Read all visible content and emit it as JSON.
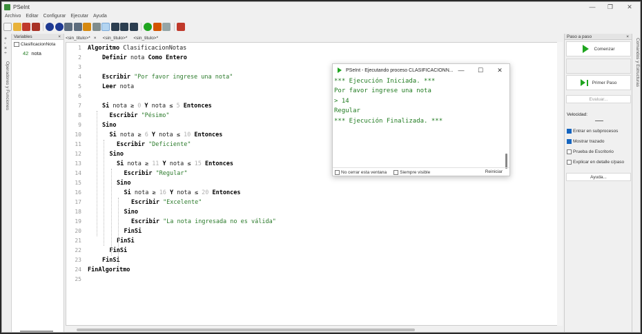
{
  "window": {
    "title": "PSeInt",
    "min": "—",
    "max": "❐",
    "close": "✕"
  },
  "menu": [
    "Archivo",
    "Editar",
    "Configurar",
    "Ejecutar",
    "Ayuda"
  ],
  "left_strip": {
    "label": "Operadores y Funciones"
  },
  "variables": {
    "header": "Variables",
    "close": "×",
    "tree_root": "ClasificacionNota",
    "var_name": "nota",
    "var_type": "42"
  },
  "tabs": [
    "<sin_titulo>*",
    "<sin_titulo>*",
    "<sin_titulo>*"
  ],
  "tab_close": "×",
  "code_lines": [
    [
      {
        "t": "Algoritmo ",
        "c": "kw"
      },
      {
        "t": "ClasificacionNotas"
      }
    ],
    [
      {
        "t": "Definir ",
        "c": "kw"
      },
      {
        "t": "nota "
      },
      {
        "t": "Como Entero",
        "c": "kw"
      }
    ],
    [],
    [
      {
        "t": "Escribir ",
        "c": "kw"
      },
      {
        "t": "\"Por favor ingrese una nota\"",
        "c": "str"
      }
    ],
    [
      {
        "t": "Leer ",
        "c": "kw"
      },
      {
        "t": "nota"
      }
    ],
    [],
    [
      {
        "t": "Si ",
        "c": "kw"
      },
      {
        "t": "nota ≥ "
      },
      {
        "t": "0",
        "c": "num"
      },
      {
        "t": " Y ",
        "c": "kw"
      },
      {
        "t": "nota ≤ "
      },
      {
        "t": "5",
        "c": "num"
      },
      {
        "t": " Entonces",
        "c": "kw"
      }
    ],
    [
      {
        "t": "Escribir ",
        "c": "kw"
      },
      {
        "t": "\"Pésimo\"",
        "c": "str"
      }
    ],
    [
      {
        "t": "Sino",
        "c": "kw"
      }
    ],
    [
      {
        "t": "Si ",
        "c": "kw"
      },
      {
        "t": "nota ≥ "
      },
      {
        "t": "6",
        "c": "num"
      },
      {
        "t": " Y ",
        "c": "kw"
      },
      {
        "t": "nota ≤ "
      },
      {
        "t": "10",
        "c": "num"
      },
      {
        "t": " Entonces",
        "c": "kw"
      }
    ],
    [
      {
        "t": "Escribir ",
        "c": "kw"
      },
      {
        "t": "\"Deficiente\"",
        "c": "str"
      }
    ],
    [
      {
        "t": "Sino",
        "c": "kw"
      }
    ],
    [
      {
        "t": "Si ",
        "c": "kw"
      },
      {
        "t": "nota ≥ "
      },
      {
        "t": "11",
        "c": "num"
      },
      {
        "t": " Y ",
        "c": "kw"
      },
      {
        "t": "nota ≤ "
      },
      {
        "t": "15",
        "c": "num"
      },
      {
        "t": " Entonces",
        "c": "kw"
      }
    ],
    [
      {
        "t": "Escribir ",
        "c": "kw"
      },
      {
        "t": "\"Regular\"",
        "c": "str"
      }
    ],
    [
      {
        "t": "Sino",
        "c": "kw"
      }
    ],
    [
      {
        "t": "Si ",
        "c": "kw"
      },
      {
        "t": "nota ≥ "
      },
      {
        "t": "16",
        "c": "num"
      },
      {
        "t": " Y ",
        "c": "kw"
      },
      {
        "t": "nota ≤ "
      },
      {
        "t": "20",
        "c": "num"
      },
      {
        "t": " Entonces",
        "c": "kw"
      }
    ],
    [
      {
        "t": "Escribir ",
        "c": "kw"
      },
      {
        "t": "\"Excelente\"",
        "c": "str"
      }
    ],
    [
      {
        "t": "Sino",
        "c": "kw"
      }
    ],
    [
      {
        "t": "Escribir ",
        "c": "kw"
      },
      {
        "t": "\"La nota ingresada no es válida\"",
        "c": "str"
      }
    ],
    [
      {
        "t": "FinSi",
        "c": "kw"
      }
    ],
    [
      {
        "t": "FinSi",
        "c": "kw"
      }
    ],
    [
      {
        "t": "FinSi",
        "c": "kw"
      }
    ],
    [
      {
        "t": "FinSi",
        "c": "kw"
      }
    ],
    [
      {
        "t": "FinAlgoritmo",
        "c": "kw"
      }
    ],
    []
  ],
  "right_panel": {
    "header": "Paso a paso",
    "close": "×",
    "comenzar": "Comenzar",
    "primer_paso": "Primer Paso",
    "evaluar": "Evaluar...",
    "velocidad": "Velocidad:",
    "options": [
      {
        "label": "Entrar en subprocesos",
        "checked": true
      },
      {
        "label": "Mostrar trazado",
        "checked": true
      },
      {
        "label": "Prueba de Escritorio",
        "checked": false
      },
      {
        "label": "Explicar en detalle c/paso",
        "checked": false
      }
    ],
    "ayuda": "Ayuda..."
  },
  "right_strip": {
    "label": "Comandos y Estructuras"
  },
  "exec_dialog": {
    "title": "PSeInt - Ejecutando proceso CLASIFICACIONN...",
    "min": "—",
    "max": "☐",
    "close": "✕",
    "output": [
      "*** Ejecución Iniciada. ***",
      "Por favor ingrese una nota",
      "> 14",
      "Regular",
      "*** Ejecución Finalizada. ***"
    ],
    "no_cerrar": "No cerrar esta ventana",
    "siempre_visible": "Siempre visible",
    "reiniciar": "Reiniciar"
  }
}
